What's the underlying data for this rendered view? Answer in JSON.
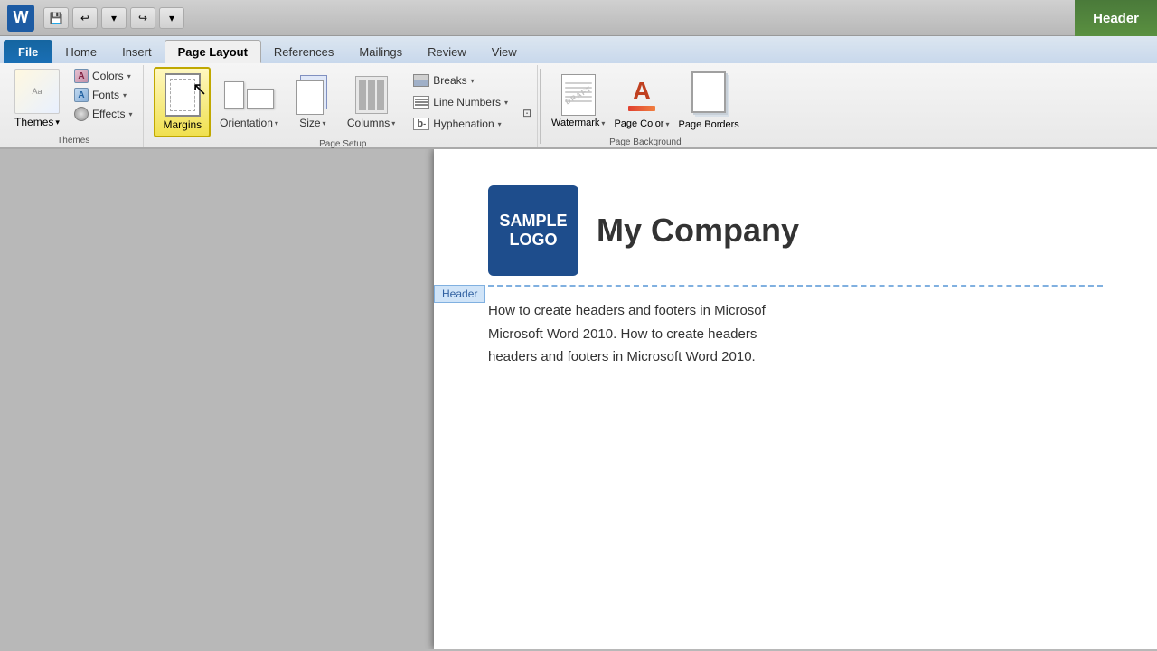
{
  "titlebar": {
    "word_icon": "W",
    "header_tab": "Header"
  },
  "qat": {
    "save": "💾",
    "undo": "↩",
    "undo_arrow": "▾",
    "redo": "↪",
    "more": "▾"
  },
  "tabs": [
    {
      "id": "file",
      "label": "File",
      "active": false,
      "isFile": true
    },
    {
      "id": "home",
      "label": "Home",
      "active": false
    },
    {
      "id": "insert",
      "label": "Insert",
      "active": false
    },
    {
      "id": "page-layout",
      "label": "Page Layout",
      "active": true
    },
    {
      "id": "references",
      "label": "References",
      "active": false
    },
    {
      "id": "mailings",
      "label": "Mailings",
      "active": false
    },
    {
      "id": "review",
      "label": "Review",
      "active": false
    },
    {
      "id": "view",
      "label": "View",
      "active": false
    }
  ],
  "ribbon": {
    "themes_group": {
      "label": "Themes",
      "themes_btn": "Themes",
      "themes_chevron": "▾",
      "colors_btn": "Colors",
      "colors_chevron": "▾",
      "fonts_btn": "Fonts",
      "fonts_chevron": "▾",
      "effects_btn": "Effects",
      "effects_chevron": "▾"
    },
    "page_setup_group": {
      "label": "Page Setup",
      "margins_btn": "Margins",
      "orientation_btn": "Orientation",
      "size_btn": "Size",
      "columns_btn": "Columns",
      "breaks_btn": "Breaks",
      "breaks_chevron": "▾",
      "line_numbers_btn": "Line Numbers",
      "line_numbers_chevron": "▾",
      "hyphenation_btn": "Hyphenation",
      "hyphenation_chevron": "▾",
      "dialog_launcher": "⊡"
    },
    "page_background_group": {
      "label": "Page Background",
      "watermark_btn": "Watermark",
      "watermark_chevron": "▾",
      "page_color_btn": "Page Color",
      "page_color_chevron": "▾",
      "page_borders_btn": "Page Borders"
    }
  },
  "document": {
    "logo_line1": "SAMPLE",
    "logo_line2": "LOGO",
    "company_name": "My Company",
    "header_label": "Header",
    "body_text_1": "How to create headers and footers in Microsof",
    "body_text_2": "Microsoft Word 2010.  How to create headers",
    "body_text_3": "headers and footers in Microsoft Word 2010."
  }
}
